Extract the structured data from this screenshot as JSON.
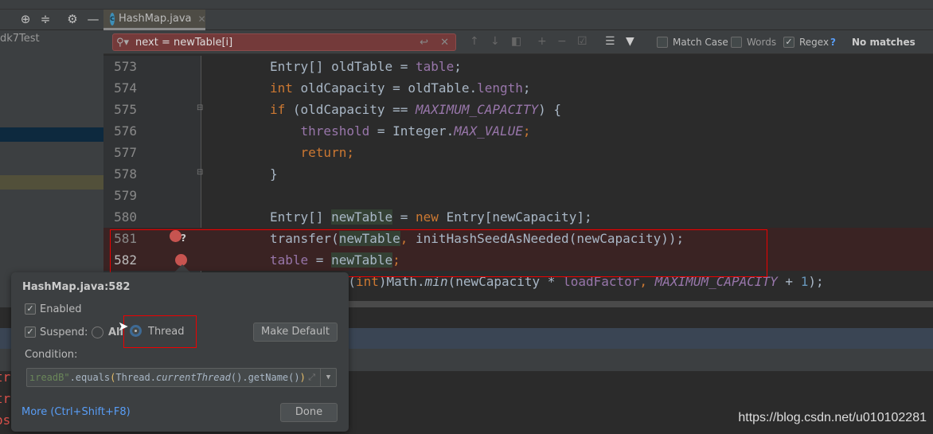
{
  "tab": {
    "label": "HashMap.java",
    "icon": "class-icon"
  },
  "sidebar": {
    "project": "dk7Test"
  },
  "find": {
    "value": "next = newTable[i]",
    "match_case": "Match Case",
    "match_case_checked": false,
    "words": "Words",
    "words_checked": false,
    "regex": "Regex",
    "regex_checked": true,
    "help": "?",
    "status": "No matches"
  },
  "code": [
    {
      "n": "573",
      "t": [
        [
          "",
          "Entry[] oldTable = "
        ],
        [
          "fd",
          "table"
        ],
        [
          "",
          ";"
        ]
      ]
    },
    {
      "n": "574",
      "t": [
        [
          "kw",
          "int "
        ],
        [
          "",
          "oldCapacity = oldTable."
        ],
        [
          "fd",
          "length"
        ],
        [
          "",
          ";"
        ]
      ]
    },
    {
      "n": "575",
      "t": [
        [
          "kw",
          "if "
        ],
        [
          "",
          "(oldCapacity == "
        ],
        [
          "fd it",
          "MAXIMUM_CAPACITY"
        ],
        [
          "",
          ") {"
        ]
      ]
    },
    {
      "n": "576",
      "t": [
        [
          "",
          "    "
        ],
        [
          "fd",
          "threshold"
        ],
        [
          "",
          " = Integer."
        ],
        [
          "fd it",
          "MAX_VALUE"
        ],
        [
          "kw",
          ";"
        ]
      ]
    },
    {
      "n": "577",
      "t": [
        [
          "",
          "    "
        ],
        [
          "kw",
          "return;"
        ]
      ]
    },
    {
      "n": "578",
      "t": [
        [
          "",
          "}"
        ]
      ]
    },
    {
      "n": "579",
      "t": []
    },
    {
      "n": "580",
      "t": [
        [
          "",
          "Entry[] "
        ],
        [
          "hl",
          "newTable"
        ],
        [
          "",
          " = "
        ],
        [
          "kw",
          "new "
        ],
        [
          "",
          "Entry[newCapacity];"
        ]
      ]
    },
    {
      "n": "581",
      "t": [
        [
          "",
          "transfer("
        ],
        [
          "hl",
          "newTable"
        ],
        [
          "kw",
          ", "
        ],
        [
          "",
          "initHashSeedAsNeeded(newCapacity));"
        ]
      ]
    },
    {
      "n": "582",
      "t": [
        [
          "fd",
          "table"
        ],
        [
          "",
          " = "
        ],
        [
          "hl",
          "newTable"
        ],
        [
          "kw",
          ";"
        ]
      ]
    },
    {
      "n": "583",
      "t": [
        [
          "",
          "        = ("
        ],
        [
          "kw",
          "int"
        ],
        [
          "",
          ")Math."
        ],
        [
          "it",
          "min"
        ],
        [
          "",
          "(newCapacity * "
        ],
        [
          "fd",
          "loadFactor"
        ],
        [
          "kw",
          ", "
        ],
        [
          "fd it",
          "MAXIMUM_CAPACITY"
        ],
        [
          "",
          " + "
        ],
        [
          "num",
          "1"
        ],
        [
          "",
          "); "
        ]
      ]
    }
  ],
  "console": {
    "lines": [
      "tr",
      "tr",
      "os"
    ]
  },
  "popup": {
    "title": "HashMap.java:582",
    "enabled": "Enabled",
    "enabled_checked": true,
    "suspend": "Suspend:",
    "suspend_checked": true,
    "all": "All",
    "thread": "Thread",
    "selected": "Thread",
    "make_default": "Make Default",
    "condition_label": "Condition:",
    "condition": {
      "str": "ıreadB\"",
      "a": ".equals",
      "p1": "(",
      "b": "Thread.",
      "c": "currentThread",
      "d": "().getName()",
      "p2": ")"
    },
    "more": "More (Ctrl+Shift+F8)",
    "done": "Done"
  },
  "watermark": "https://blog.csdn.net/u010102281",
  "colors": {
    "keyword": "#cc7832",
    "field": "#9876aa",
    "breakpoint": "#c75450",
    "search_error": "#743a3a",
    "link": "#589df6"
  }
}
